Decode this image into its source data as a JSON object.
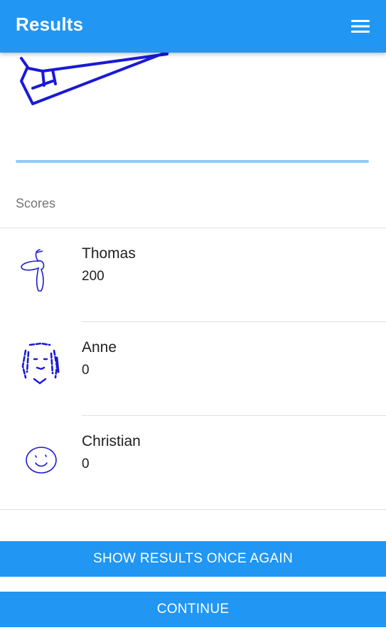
{
  "appbar": {
    "title": "Results",
    "menu_icon": "hamburger-menu-icon",
    "color": "#2196f3"
  },
  "drawing": {
    "stroke_color": "#1a1ad6"
  },
  "scores": {
    "label": "Scores",
    "players": [
      {
        "name": "Thomas",
        "score": "200",
        "avatar_icon": "doodle-avatar-thomas"
      },
      {
        "name": "Anne",
        "score": "0",
        "avatar_icon": "doodle-avatar-anne"
      },
      {
        "name": "Christian",
        "score": "0",
        "avatar_icon": "doodle-avatar-smiley"
      }
    ]
  },
  "buttons": {
    "show_again": "SHOW RESULTS ONCE AGAIN",
    "continue": "CONTINUE"
  }
}
